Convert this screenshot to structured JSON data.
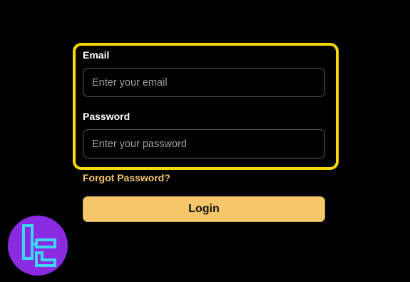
{
  "form": {
    "email_label": "Email",
    "email_placeholder": "Enter your email",
    "email_value": "",
    "password_label": "Password",
    "password_placeholder": "Enter your password",
    "password_value": "",
    "forgot_password_label": "Forgot Password?",
    "login_label": "Login"
  },
  "logo": {
    "icon": "tradingfinder-logo-icon"
  },
  "colors": {
    "background": "#000000",
    "highlight_border": "#f5d90a",
    "accent": "#f6c66b",
    "logo_background": "#8a2be2",
    "logo_glyph": "#3fd6f5"
  }
}
